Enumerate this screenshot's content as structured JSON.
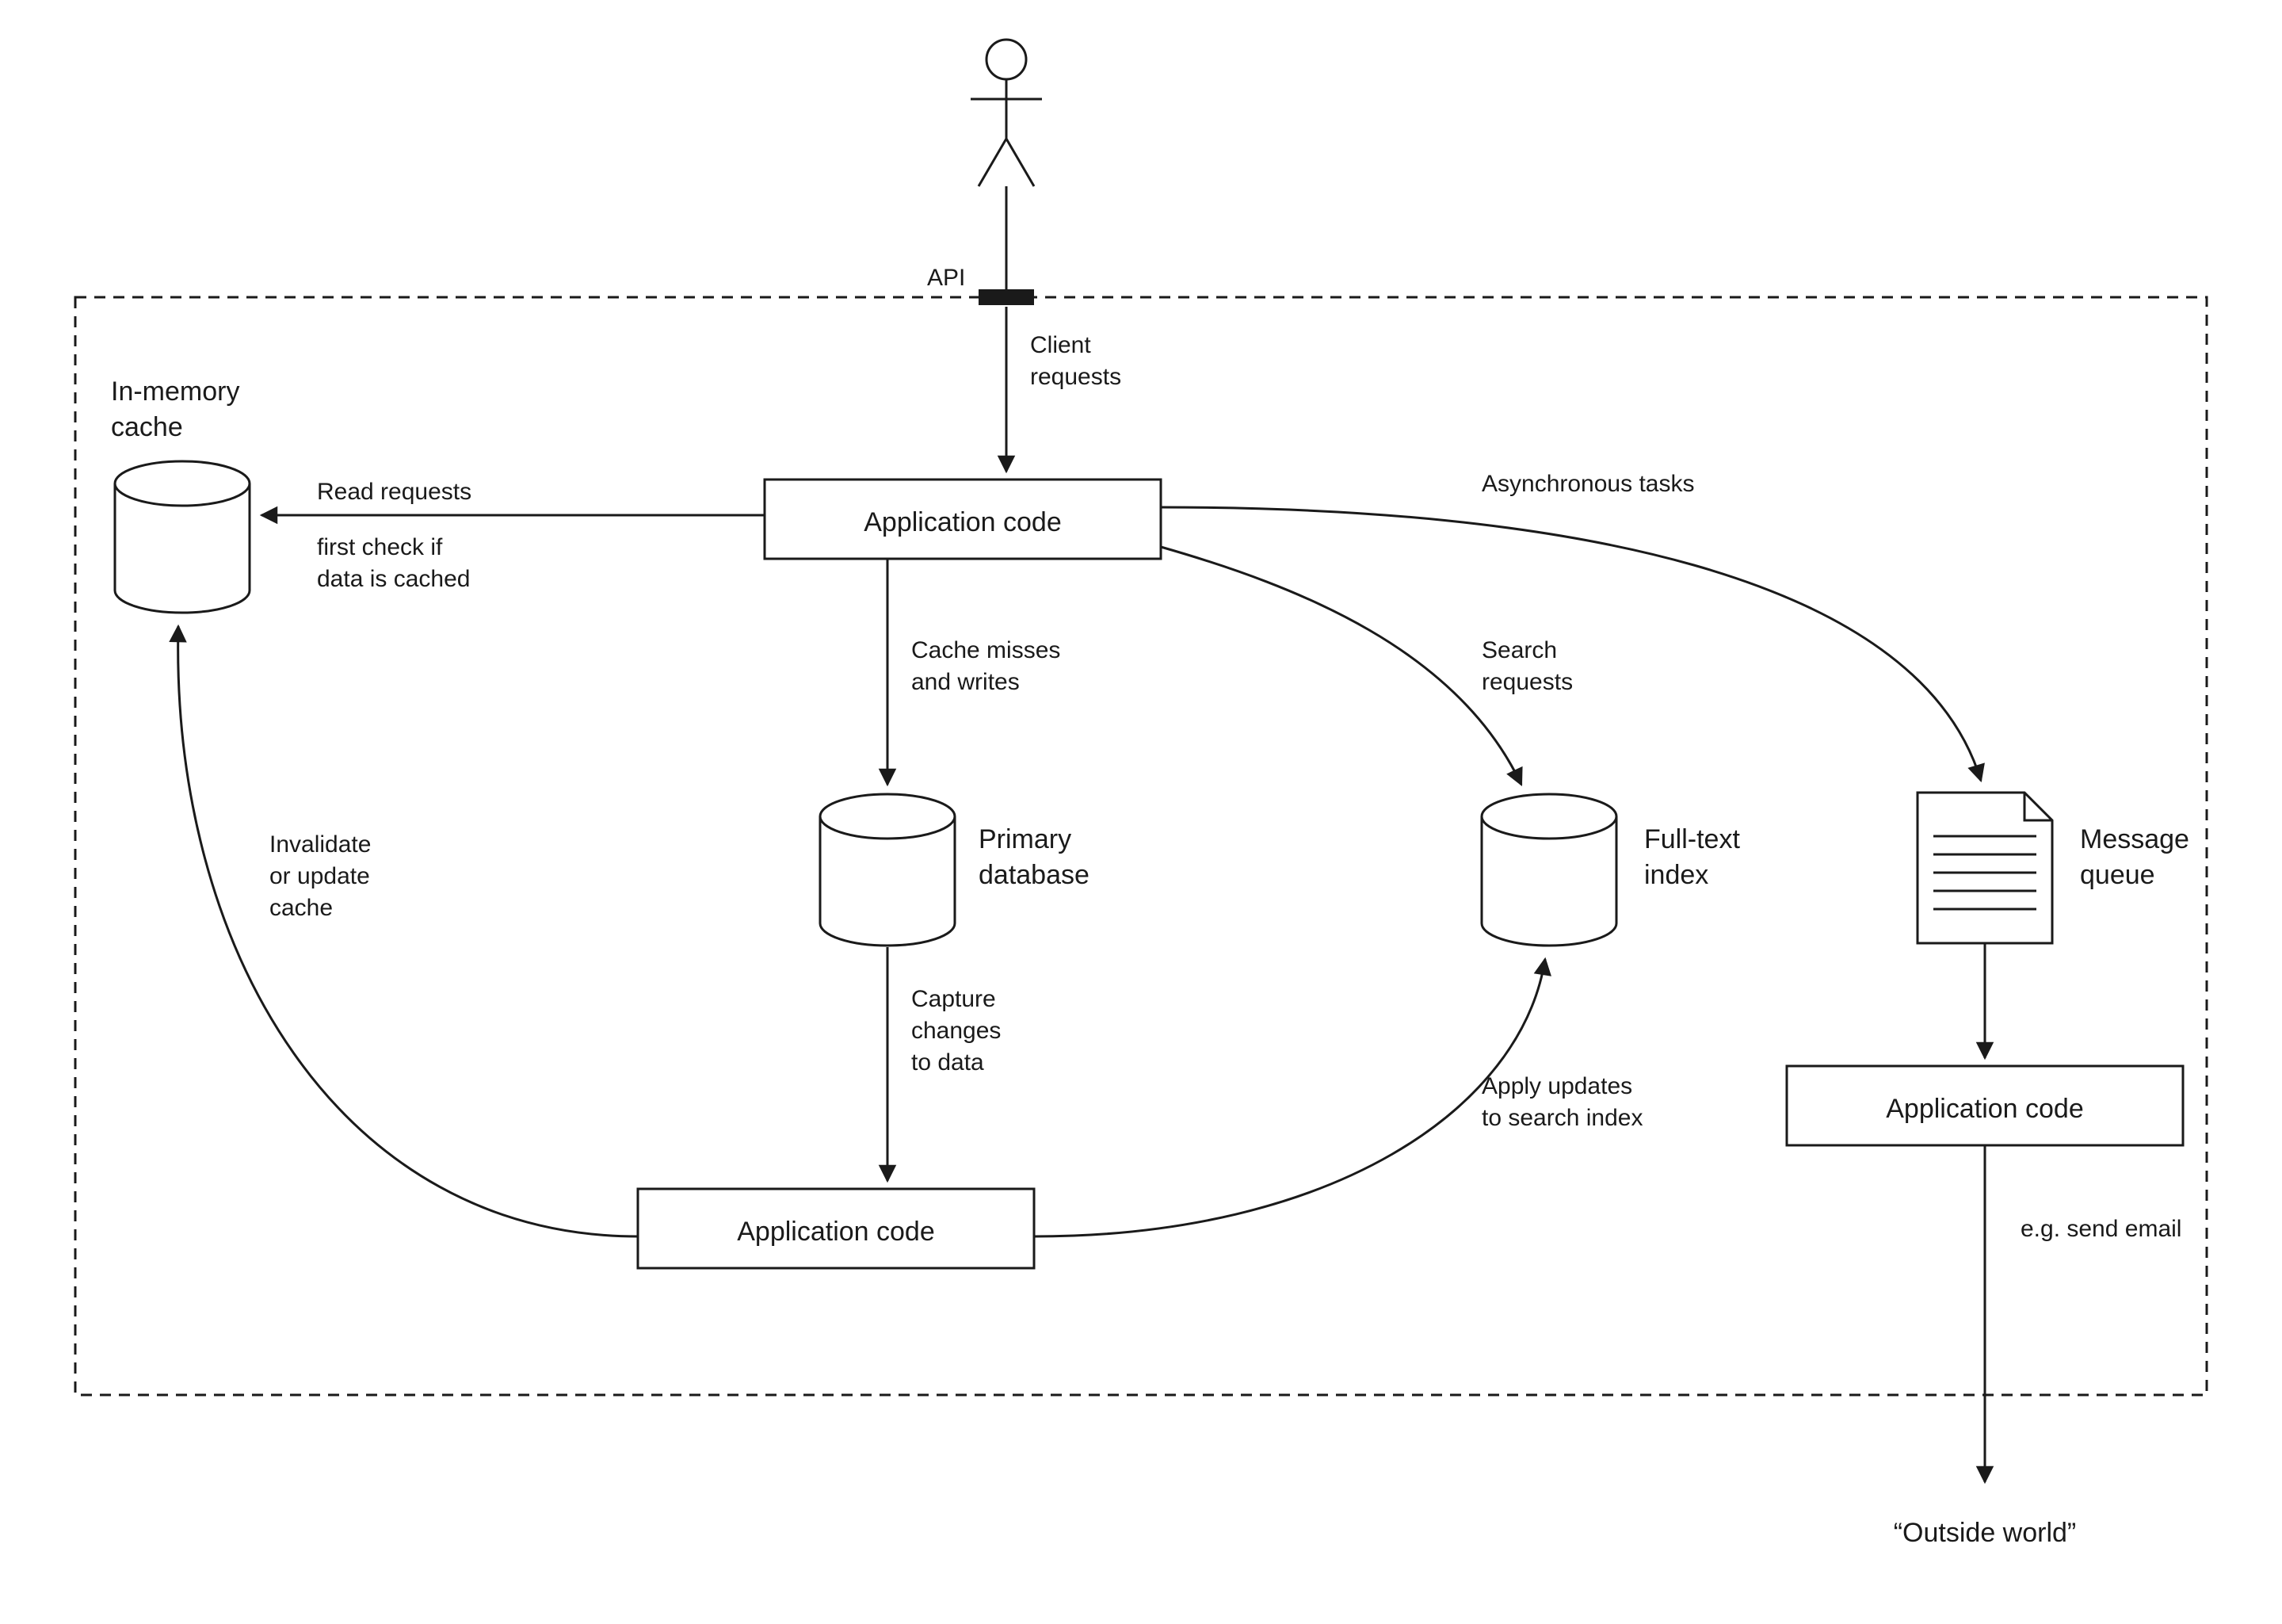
{
  "nodes": {
    "cache": {
      "label1": "In-memory",
      "label2": "cache"
    },
    "app_top": {
      "label": "Application code"
    },
    "primary_db": {
      "label1": "Primary",
      "label2": "database"
    },
    "fulltext": {
      "label1": "Full-text",
      "label2": "index"
    },
    "msg_queue": {
      "label1": "Message",
      "label2": "queue"
    },
    "app_mid": {
      "label": "Application code"
    },
    "app_right": {
      "label": "Application code"
    },
    "outside": {
      "label": "“Outside world”"
    },
    "api": {
      "label": "API"
    }
  },
  "edges": {
    "client_requests": {
      "label1": "Client",
      "label2": "requests"
    },
    "read_requests": {
      "label1": "Read requests",
      "label2": "first check if",
      "label3": "data is cached"
    },
    "cache_misses": {
      "label1": "Cache misses",
      "label2": "and writes"
    },
    "search_requests": {
      "label1": "Search",
      "label2": "requests"
    },
    "async_tasks": {
      "label": "Asynchronous tasks"
    },
    "capture_changes": {
      "label1": "Capture",
      "label2": "changes",
      "label3": "to data"
    },
    "invalidate": {
      "label1": "Invalidate",
      "label2": "or update",
      "label3": "cache"
    },
    "apply_updates": {
      "label1": "Apply updates",
      "label2": "to search index"
    },
    "send_email": {
      "label": "e.g. send email"
    }
  }
}
